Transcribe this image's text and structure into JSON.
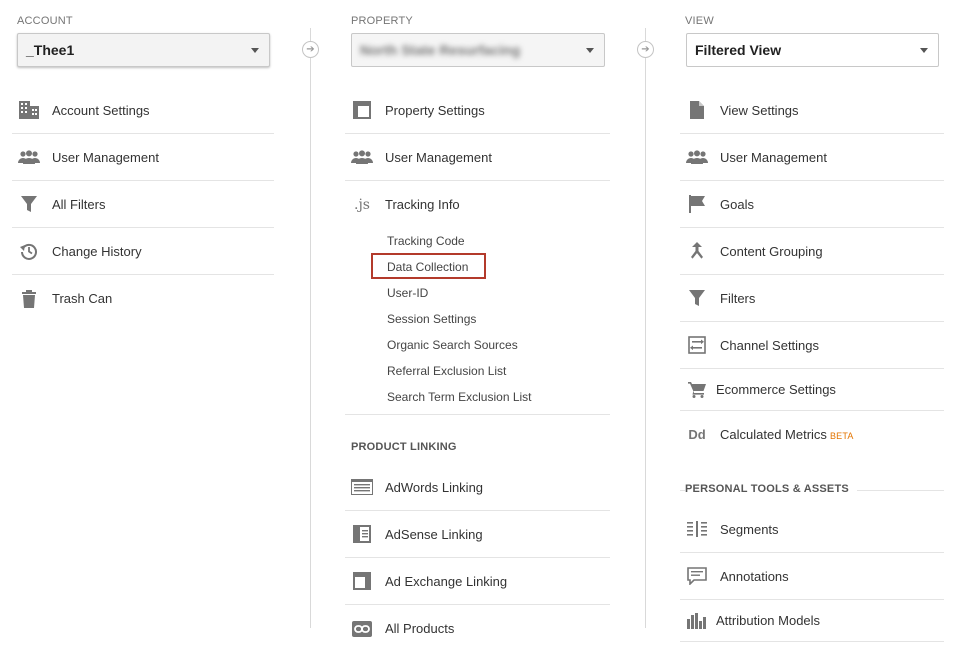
{
  "account": {
    "label": "ACCOUNT",
    "selected": "_Thee1",
    "items": [
      {
        "label": "Account Settings",
        "icon": "building-icon"
      },
      {
        "label": "User Management",
        "icon": "people-icon"
      },
      {
        "label": "All Filters",
        "icon": "filter-icon"
      },
      {
        "label": "Change History",
        "icon": "history-icon"
      },
      {
        "label": "Trash Can",
        "icon": "trash-icon"
      }
    ]
  },
  "property": {
    "label": "PROPERTY",
    "selected": "North State Resurfacing",
    "items": [
      {
        "label": "Property Settings",
        "icon": "layout-icon"
      },
      {
        "label": "User Management",
        "icon": "people-icon"
      },
      {
        "label": "Tracking Info",
        "icon": "js-icon",
        "glyph": ".js"
      }
    ],
    "tracking_sub": [
      "Tracking Code",
      "Data Collection",
      "User-ID",
      "Session Settings",
      "Organic Search Sources",
      "Referral Exclusion List",
      "Search Term Exclusion List"
    ],
    "product_linking": {
      "heading": "PRODUCT LINKING",
      "items": [
        {
          "label": "AdWords Linking",
          "icon": "adwords-icon"
        },
        {
          "label": "AdSense Linking",
          "icon": "adsense-icon"
        },
        {
          "label": "Ad Exchange Linking",
          "icon": "adexchange-icon"
        },
        {
          "label": "All Products",
          "icon": "link-icon"
        }
      ]
    }
  },
  "view": {
    "label": "VIEW",
    "selected": "Filtered View",
    "items": [
      {
        "label": "View Settings",
        "icon": "document-icon"
      },
      {
        "label": "User Management",
        "icon": "people-icon"
      },
      {
        "label": "Goals",
        "icon": "flag-icon"
      },
      {
        "label": "Content Grouping",
        "icon": "merge-icon"
      },
      {
        "label": "Filters",
        "icon": "filter-icon"
      },
      {
        "label": "Channel Settings",
        "icon": "channel-icon"
      },
      {
        "label": "Ecommerce Settings",
        "icon": "cart-icon"
      },
      {
        "label": "Calculated Metrics",
        "icon": "dd-icon",
        "glyph": "Dd",
        "badge": "BETA"
      }
    ],
    "personal_tools": {
      "heading": "PERSONAL TOOLS & ASSETS",
      "items": [
        {
          "label": "Segments",
          "icon": "segments-icon"
        },
        {
          "label": "Annotations",
          "icon": "comment-icon"
        },
        {
          "label": "Attribution Models",
          "icon": "bar-chart-icon"
        }
      ]
    }
  },
  "colors": {
    "highlight_border": "#b33a2b",
    "beta": "#e37400",
    "icon": "#757575"
  }
}
